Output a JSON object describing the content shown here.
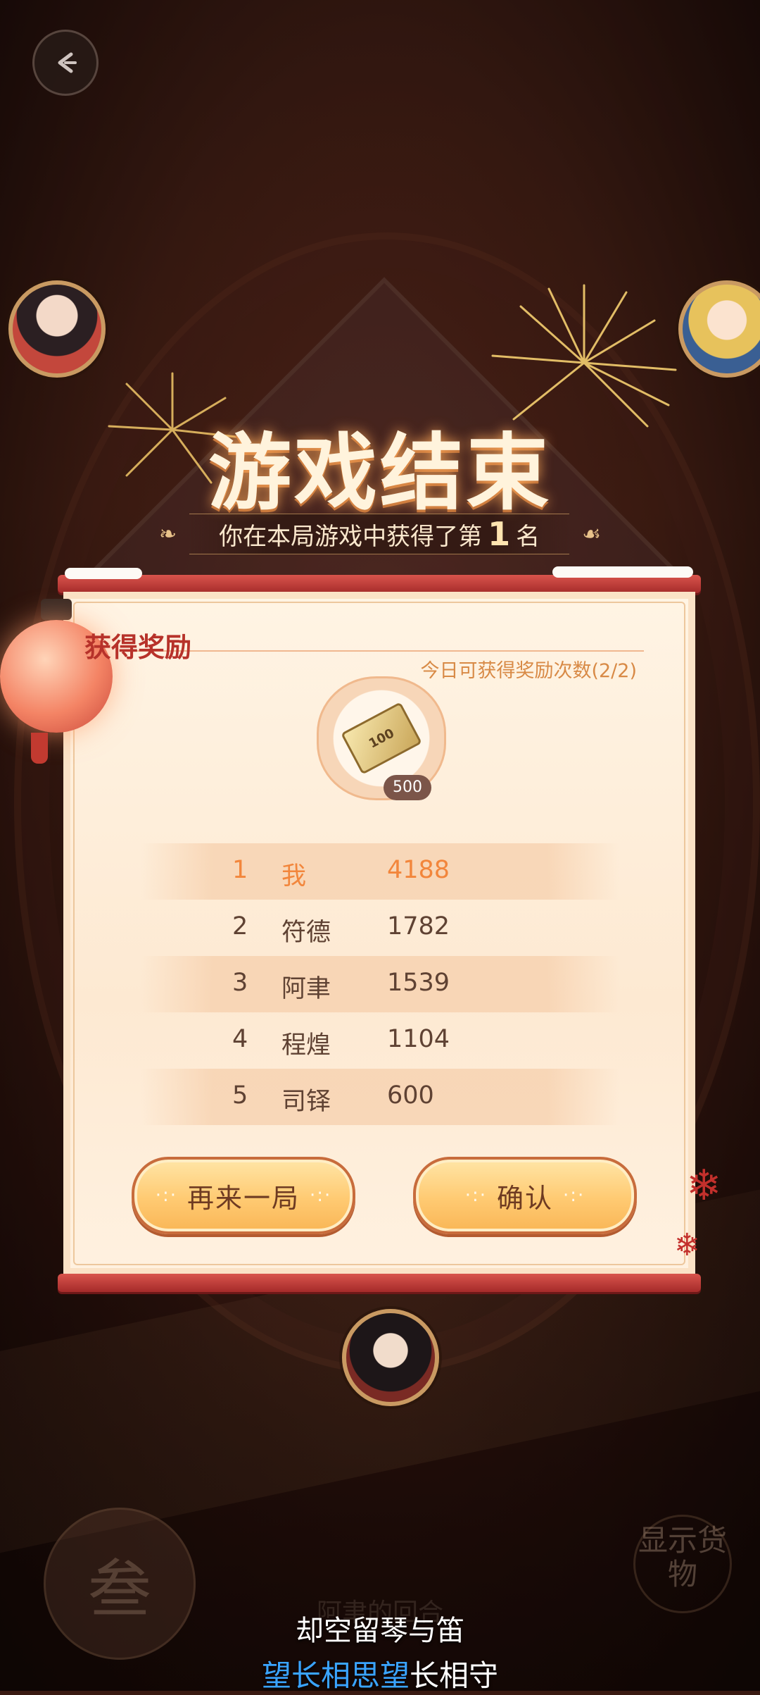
{
  "header": {
    "back_icon": "back-arrow-icon"
  },
  "result": {
    "title": "游戏结束",
    "rank_prefix": "你在本局游戏中获得了第",
    "rank_value": "1",
    "rank_suffix": "名"
  },
  "rewards": {
    "title": "获得奖励",
    "daily_count": "今日可获得奖励次数(2/2)",
    "item": {
      "icon": "ticket-100-icon",
      "ticket_text": "100",
      "quantity": "500"
    }
  },
  "ranking": [
    {
      "rank": "1",
      "name": "我",
      "score": "4188"
    },
    {
      "rank": "2",
      "name": "符德",
      "score": "1782"
    },
    {
      "rank": "3",
      "name": "阿聿",
      "score": "1539"
    },
    {
      "rank": "4",
      "name": "程煌",
      "score": "1104"
    },
    {
      "rank": "5",
      "name": "司铎",
      "score": "600"
    }
  ],
  "buttons": {
    "replay": "再来一局",
    "confirm": "确认"
  },
  "background": {
    "badge_char": "叁",
    "show_goods": "显示货物",
    "round_hint": "阿聿的回合"
  },
  "lyrics": {
    "line1": "却空留琴与笛",
    "line2_highlight": "望长相思望",
    "line2_rest": "长相守"
  },
  "colors": {
    "accent_red": "#b7322a",
    "rank_highlight": "#f2863c",
    "button_fill": "#ffca72",
    "lyric_highlight": "#3aa4ff"
  }
}
